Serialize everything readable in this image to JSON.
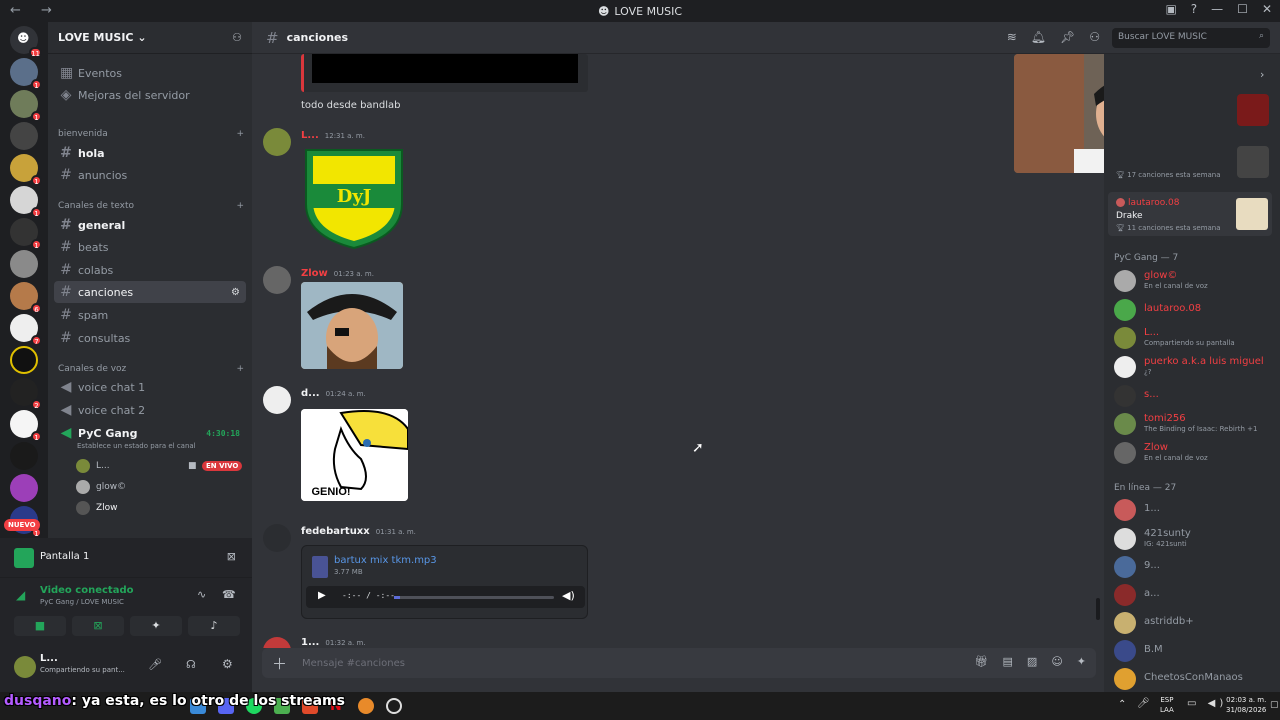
{
  "window": {
    "title": "LOVE MUSIC"
  },
  "guild": {
    "name": "LOVE MUSIC",
    "chevron": "chevron-down-icon"
  },
  "nav_top": [
    {
      "label": "Eventos"
    },
    {
      "label": "Mejoras del servidor"
    }
  ],
  "categories": {
    "bienvenida": "bienvenida",
    "texto": "Canales de texto",
    "voz": "Canales de voz"
  },
  "channels": {
    "hola": "hola",
    "anuncios": "anuncios",
    "general": "general",
    "beats": "beats",
    "colabs": "colabs",
    "canciones": "canciones",
    "spam": "spam",
    "consultas": "consultas",
    "voice1": "voice chat 1",
    "voice2": "voice chat 2"
  },
  "voice": {
    "channel": "PyC Gang",
    "timer": "4:30:18",
    "status": "Establece un estado para el canal",
    "users": [
      {
        "name": "L..."
      },
      {
        "name": "glow©"
      },
      {
        "name": "Zlow"
      }
    ],
    "live_label": "EN VIVO"
  },
  "server_badges": [
    "11",
    "1",
    "1",
    "",
    "1",
    "1",
    "1",
    "",
    "",
    "6",
    "7",
    "",
    "2",
    "1",
    "",
    "",
    "1"
  ],
  "new_label": "NUEVO",
  "screenshare": {
    "title": "Pantalla 1"
  },
  "voice_panel": {
    "status": "Video conectado",
    "location": "PyC Gang / LOVE MUSIC"
  },
  "user_panel": {
    "name": "L...",
    "status": "Compartiendo su pant..."
  },
  "topbar": {
    "channel": "canciones",
    "search_placeholder": "Buscar LOVE MUSIC"
  },
  "messages": [
    {
      "text": "todo desde bandlab"
    },
    {
      "author": "L...",
      "time": "12:31 a. m.",
      "image": "DyJ"
    },
    {
      "author": "Zlow",
      "time": "01:23 a. m."
    },
    {
      "author": "d...",
      "time": "01:24 a. m.",
      "image_text": "GENIO!"
    },
    {
      "author": "fedebartuxx",
      "time": "01:31 a. m.",
      "file": "bartux mix tkm.mp3",
      "size": "3.77 MB",
      "player": "-:-- / -:--"
    },
    {
      "author": "1...",
      "time": "01:32 a. m."
    }
  ],
  "composer": {
    "placeholder": "Mensaje #canciones"
  },
  "members": {
    "top_rows": [
      {
        "act": "17 canciones esta semana"
      },
      {
        "name": "lautaroo.08",
        "sub": "Drake",
        "act": "11 canciones esta semana"
      }
    ],
    "group1": "PyC Gang — 7",
    "g1": [
      {
        "name": "glow©",
        "act": "En el canal de voz",
        "color": "#f23f43"
      },
      {
        "name": "lautaroo.08",
        "act": "",
        "color": "#f23f43"
      },
      {
        "name": "L...",
        "act": "Compartiendo su pantalla",
        "color": "#f23f43"
      },
      {
        "name": "puerko a.k.a luis miguel",
        "act": "¿?",
        "color": "#f23f43"
      },
      {
        "name": "s...",
        "act": "",
        "color": "#f23f43"
      },
      {
        "name": "tomi256",
        "act": "The Binding of Isaac: Rebirth +1",
        "color": "#f23f43"
      },
      {
        "name": "Zlow",
        "act": "En el canal de voz",
        "color": "#f23f43"
      }
    ],
    "group2": "En línea — 27",
    "g2": [
      {
        "name": "1...",
        "act": ""
      },
      {
        "name": "421sunty",
        "act": "IG: 421sunti"
      },
      {
        "name": "9...",
        "act": ""
      },
      {
        "name": "a...",
        "act": ""
      },
      {
        "name": "astriddb+",
        "act": ""
      },
      {
        "name": "B.M",
        "act": ""
      },
      {
        "name": "CheetosConManaos",
        "act": ""
      }
    ]
  },
  "taskbar": {
    "lang": "ESP",
    "lang2": "LAA",
    "time": "02:03 a. m.",
    "date": "31/08/2026"
  },
  "caption": {
    "speaker": "dusqano",
    "text": ": ya esta, es lo otro de los streams"
  }
}
